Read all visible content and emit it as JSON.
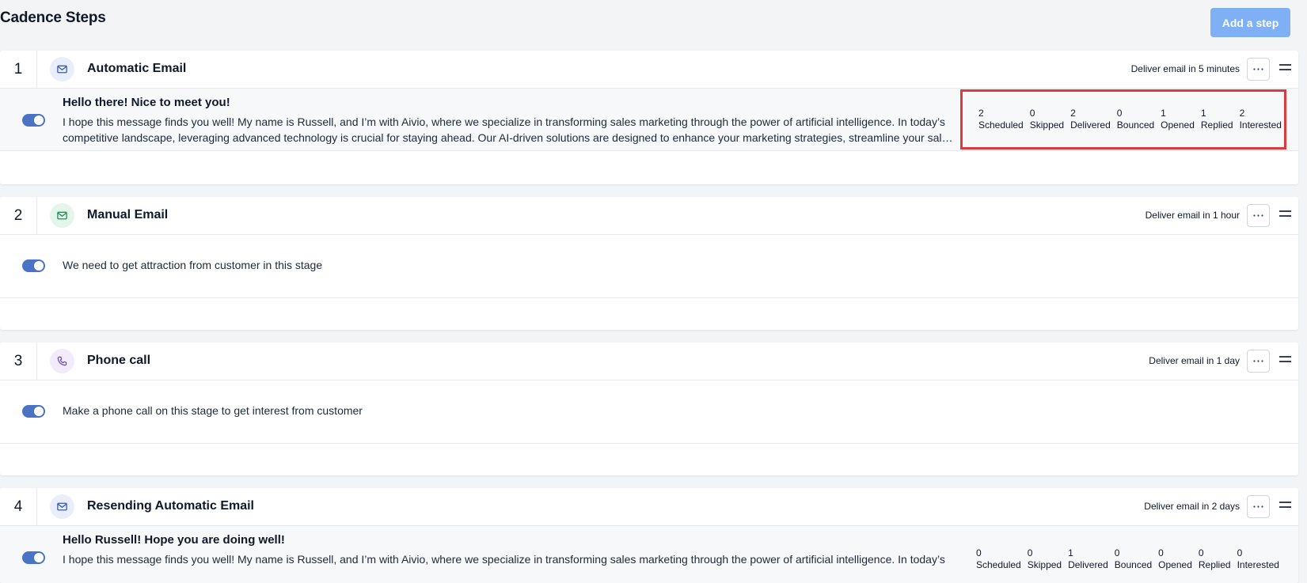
{
  "page": {
    "title": "Cadence Steps",
    "add_step_label": "Add a step",
    "accent_color": "#7fb0f5",
    "toggle_color": "#4a72c5",
    "highlight_color": "#dc3b3b"
  },
  "steps": [
    {
      "number": "1",
      "type": "Automatic Email",
      "icon": "mail-icon",
      "deliver": "Deliver email in 5 minutes",
      "enabled": true,
      "subject": "Hello there! Nice to meet you!",
      "preview": "I hope this message finds you well! My name is Russell, and I’m with Aivio, where we specialize in transforming sales marketing through the power of artificial intelligence. In today’s competitive landscape, leveraging advanced technology is crucial for staying ahead. Our AI-driven solutions are designed to enhance your marketing strategies, streamline your sales processes, and boost your results.",
      "stats": [
        {
          "value": "2",
          "label": "Scheduled"
        },
        {
          "value": "0",
          "label": "Skipped"
        },
        {
          "value": "2",
          "label": "Delivered"
        },
        {
          "value": "0",
          "label": "Bounced"
        },
        {
          "value": "1",
          "label": "Opened"
        },
        {
          "value": "1",
          "label": "Replied"
        },
        {
          "value": "2",
          "label": "Interested"
        }
      ]
    },
    {
      "number": "2",
      "type": "Manual Email",
      "icon": "mail-icon",
      "deliver": "Deliver email in 1 hour",
      "enabled": true,
      "text": "We need to get attraction from customer in this stage"
    },
    {
      "number": "3",
      "type": "Phone call",
      "icon": "phone-icon",
      "deliver": "Deliver email in 1 day",
      "enabled": true,
      "text": "Make a phone call on this stage to get interest from customer"
    },
    {
      "number": "4",
      "type": "Resending Automatic Email",
      "icon": "mail-icon",
      "deliver": "Deliver email in 2 days",
      "enabled": true,
      "subject": "Hello Russell! Hope you are doing well!",
      "preview": "I hope this message finds you well! My name is Russell, and I’m with Aivio, where we specialize in transforming sales marketing through the power of artificial intelligence. In today’s",
      "stats": [
        {
          "value": "0",
          "label": "Scheduled"
        },
        {
          "value": "0",
          "label": "Skipped"
        },
        {
          "value": "1",
          "label": "Delivered"
        },
        {
          "value": "0",
          "label": "Bounced"
        },
        {
          "value": "0",
          "label": "Opened"
        },
        {
          "value": "0",
          "label": "Replied"
        },
        {
          "value": "0",
          "label": "Interested"
        }
      ]
    }
  ]
}
